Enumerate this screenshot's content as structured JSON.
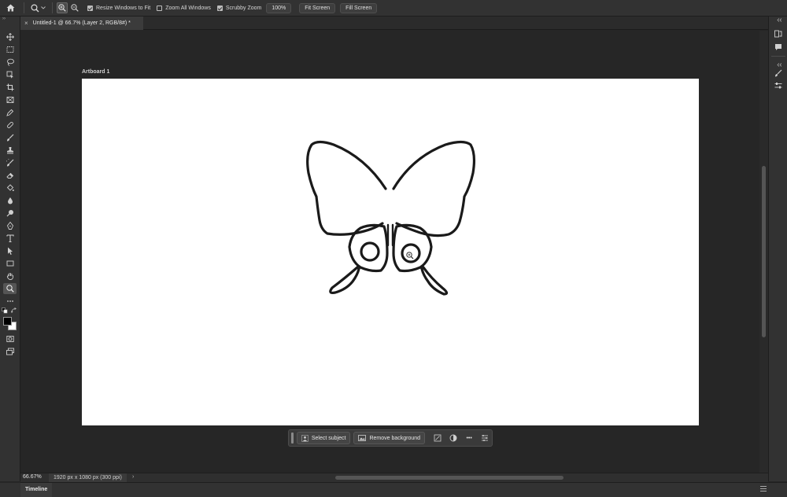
{
  "options_bar": {
    "home_icon": "home-icon",
    "tool_icon": "zoom-tool-icon",
    "checkboxes": [
      {
        "label": "Resize Windows to Fit",
        "checked": true
      },
      {
        "label": "Zoom All Windows",
        "checked": false
      },
      {
        "label": "Scrubby Zoom",
        "checked": true
      }
    ],
    "zoom_100_label": "100%",
    "fit_screen_label": "Fit Screen",
    "fill_screen_label": "Fill Screen"
  },
  "document_tab": {
    "title": "Untitled-1 @ 66.7% (Layer 2, RGB/8#) *",
    "close": "×"
  },
  "artboard": {
    "label": "Artboard 1",
    "background": "#ffffff"
  },
  "contextual_taskbar": {
    "select_subject_label": "Select subject",
    "remove_background_label": "Remove background",
    "more_label": "•••"
  },
  "status_bar": {
    "zoom": "66.67%",
    "doc_info": "1920 px x 1080 px (300 ppi)",
    "arrow": "›"
  },
  "timeline": {
    "tab_label": "Timeline"
  },
  "colors": {
    "foreground": "#000000",
    "background": "#ffffff",
    "ui_panel": "#323232",
    "canvas": "#262626"
  }
}
